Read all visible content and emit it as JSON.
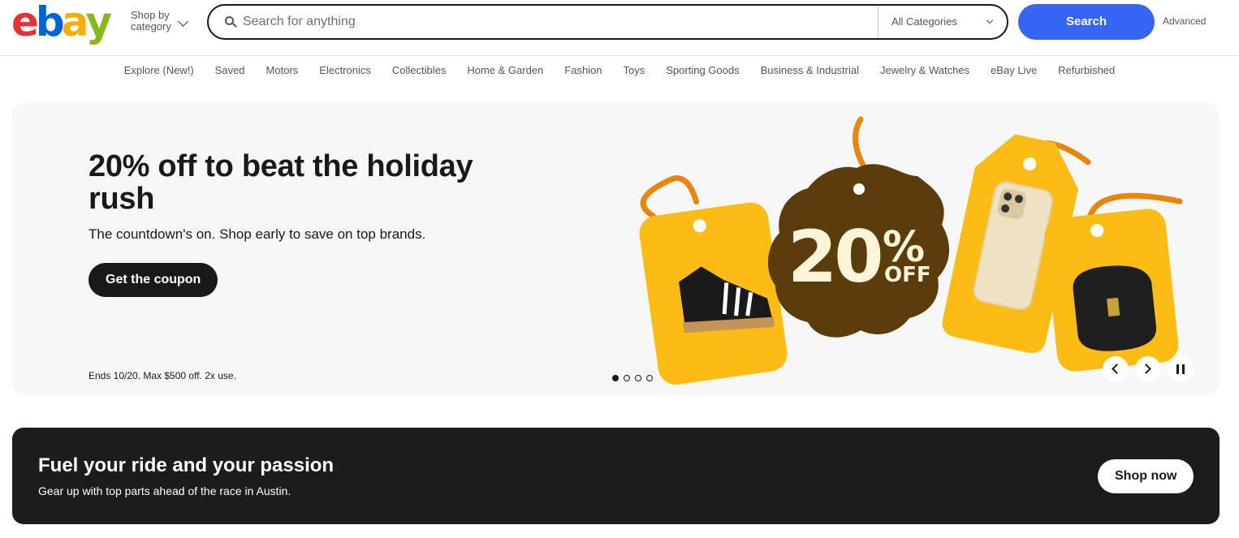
{
  "header": {
    "logo": {
      "letters": [
        "e",
        "b",
        "a",
        "y"
      ],
      "colors": [
        "#e53238",
        "#0064d2",
        "#f5af02",
        "#86b817"
      ]
    },
    "shop_by_line1": "Shop by",
    "shop_by_line2": "category",
    "search_placeholder": "Search for anything",
    "search_value": "",
    "category_selected": "All Categories",
    "search_button": "Search",
    "advanced_link": "Advanced"
  },
  "nav": {
    "items": [
      "Explore (New!)",
      "Saved",
      "Motors",
      "Electronics",
      "Collectibles",
      "Home & Garden",
      "Fashion",
      "Toys",
      "Sporting Goods",
      "Business & Industrial",
      "Jewelry & Watches",
      "eBay Live",
      "Refurbished"
    ]
  },
  "hero": {
    "title": "20% off to beat the holiday rush",
    "subtitle": "The countdown's on. Shop early to save on top brands.",
    "cta": "Get the coupon",
    "fine_print": "Ends 10/20. Max $500 off. 2x use.",
    "badge_number": "20",
    "badge_percent": "%",
    "badge_off": "OFF",
    "slides_total": 4,
    "active_slide": 1,
    "colors": {
      "background": "#f7f7f7",
      "tag": "#fbbd14",
      "badge": "#5b3d0b",
      "badge_text": "#fdf5d8",
      "string": "#e8860c"
    }
  },
  "promo": {
    "title": "Fuel your ride and your passion",
    "subtitle": "Gear up with top parts ahead of the race in Austin.",
    "cta": "Shop now"
  },
  "colors": {
    "accent": "#3665f3",
    "text": "#191919",
    "muted": "#555555"
  }
}
